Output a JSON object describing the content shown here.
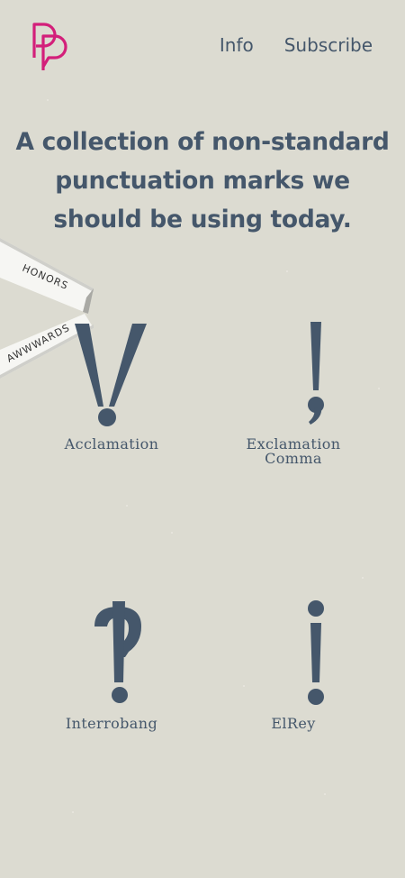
{
  "brand": {
    "icon": "pp-logo-icon",
    "accent_color": "#d31f7a"
  },
  "nav": {
    "info_label": "Info",
    "subscribe_label": "Subscribe"
  },
  "headline": "A collection of non-standard punctuation marks we should be using today.",
  "ribbon": {
    "top_text": "HONORS",
    "bottom_text": "AWWWARDS",
    "accent_color": "#2bb39a"
  },
  "marks": [
    {
      "name": "Acclamation",
      "icon": "acclamation-icon"
    },
    {
      "name": "Exclamation Comma",
      "icon": "exclamation-comma-icon"
    },
    {
      "name": "Interrobang",
      "icon": "interrobang-icon"
    },
    {
      "name": "ElRey",
      "icon": "elrey-icon"
    }
  ],
  "colors": {
    "background": "#dcdbd1",
    "text": "#45576b"
  }
}
